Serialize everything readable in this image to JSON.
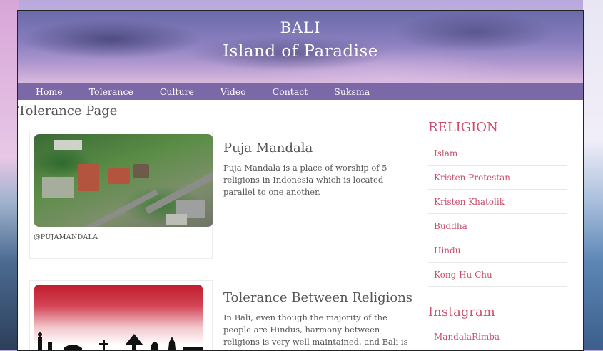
{
  "header": {
    "line1": "BALI",
    "line2": "Island of Paradise"
  },
  "nav": [
    "Home",
    "Tolerance",
    "Culture",
    "Video",
    "Contact",
    "Suksma"
  ],
  "page_title": "Tolerance Page",
  "posts": [
    {
      "title": "Puja Mandala",
      "text": "Puja Mandala is a place of worship of 5 religions in Indonesia which is located parallel to one another.",
      "caption": "@PUJAMANDALA",
      "image": "aerial-temple-complex-photo"
    },
    {
      "title": "Tolerance Between Religions",
      "text": "In Bali, even though the majority of the people are Hindus, harmony between religions is very well maintained, and Bali is",
      "image": "red-white-religious-silhouettes"
    }
  ],
  "sidebar": {
    "religion_heading": "RELIGION",
    "religions": [
      "Islam",
      "Kristen Protestan",
      "Kristen Khatolik",
      "Buddha",
      "Hindu",
      "Kong Hu Chu"
    ],
    "instagram_heading": "Instagram",
    "instagram_items": [
      "MandalaRimba"
    ]
  },
  "colors": {
    "nav_bg": "#7b68a6",
    "accent": "#c94f6b",
    "text": "#555555"
  }
}
